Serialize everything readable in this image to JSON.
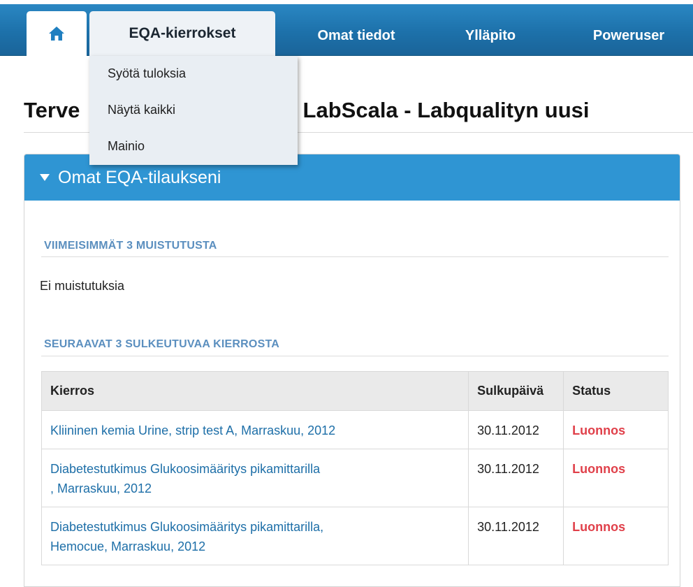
{
  "nav": {
    "tabs": [
      "EQA-kierrokset",
      "Omat tiedot",
      "Ylläpito",
      "Poweruser"
    ],
    "home_icon": "home-icon",
    "dropdown": [
      "Syötä tuloksia",
      "Näytä kaikki",
      "Mainio"
    ]
  },
  "page": {
    "title_left": "Terve",
    "title_right": "n LabScala - Labqualityn uusi"
  },
  "panel": {
    "title": "Omat EQA-tilaukseni",
    "reminders_heading": "VIIMEISIMMÄT 3 MUISTUTUSTA",
    "no_reminders": "Ei muistutuksia",
    "rounds_heading": "SEURAAVAT 3 SULKEUTUVAA KIERROSTA",
    "table": {
      "headers": [
        "Kierros",
        "Sulkupäivä",
        "Status"
      ],
      "rows": [
        {
          "kierros": "Kliininen kemia Urine, strip test A, Marraskuu, 2012",
          "date": "30.11.2012",
          "status": "Luonnos"
        },
        {
          "kierros_line1": "Diabetestutkimus Glukoosimääritys pikamittarilla",
          "kierros_line2": ", Marraskuu, 2012",
          "date": "30.11.2012",
          "status": "Luonnos"
        },
        {
          "kierros_line1": "Diabetestutkimus Glukoosimääritys pikamittarilla,",
          "kierros_line2": "Hemocue, Marraskuu, 2012",
          "date": "30.11.2012",
          "status": "Luonnos"
        }
      ]
    }
  },
  "colors": {
    "nav_blue": "#1d71aa",
    "panel_blue": "#2f95d3",
    "link": "#1e6fa8",
    "status_red": "#e0404a",
    "section_label": "#5b8fbf"
  }
}
